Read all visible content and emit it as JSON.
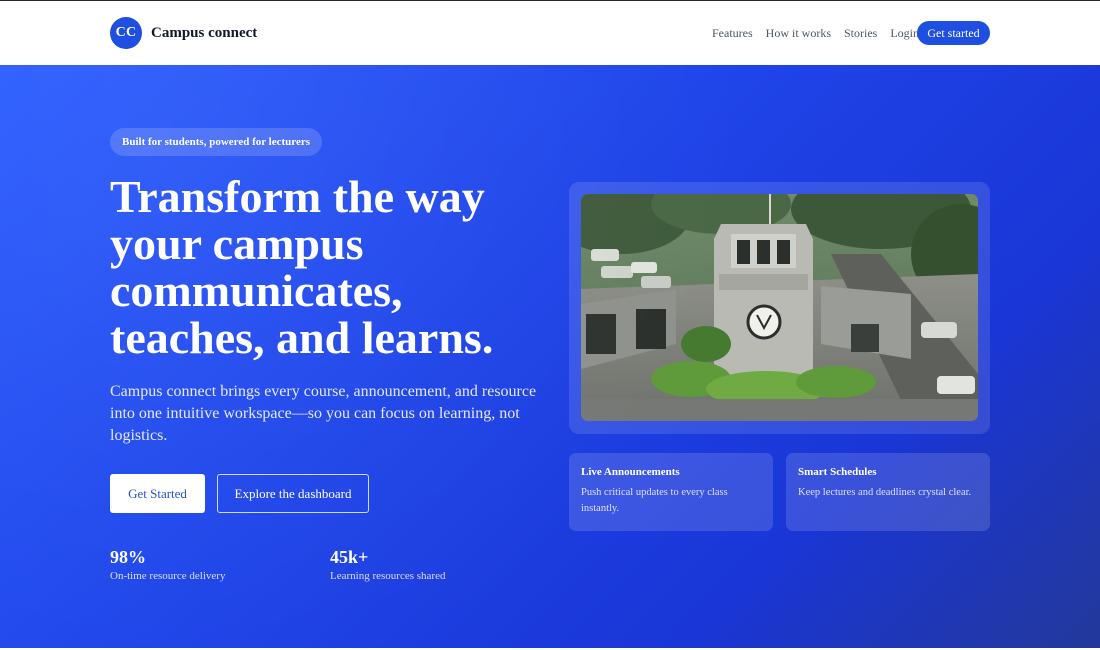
{
  "nav": {
    "logo_text": "CC",
    "brand_name": "Campus connect",
    "links": [
      "Features",
      "How it works",
      "Stories",
      "Login"
    ],
    "cta_label": "Get started"
  },
  "hero": {
    "badge": "Built for students, powered for lecturers",
    "headline_lines": [
      "Transform the way",
      "your campus",
      "communicates,",
      "teaches, and learns."
    ],
    "subtext": "Campus connect brings every course, announcement, and resource into one intuitive workspace—so you can focus on learning, not logistics.",
    "primary_button": "Get Started",
    "secondary_button": "Explore the dashboard",
    "stats": [
      {
        "value": "98%",
        "label": "On-time resource delivery"
      },
      {
        "value": "45k+",
        "label": "Learning resources shared"
      }
    ]
  },
  "showcase": {
    "image_alt": "Campus gate building photo"
  },
  "features": [
    {
      "title": "Live Announcements",
      "description": "Push critical updates to every class instantly."
    },
    {
      "title": "Smart Schedules",
      "description": "Keep lectures and deadlines crystal clear."
    }
  ],
  "colors": {
    "accent": "#1e4fe0",
    "hero_start": "#2a5cff",
    "hero_end": "#23389a",
    "text_dark": "#111827"
  }
}
